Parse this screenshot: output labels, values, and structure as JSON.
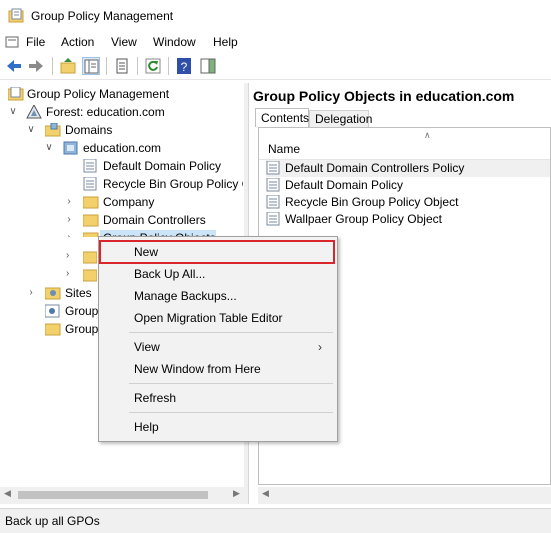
{
  "window": {
    "title": "Group Policy Management"
  },
  "menubar": {
    "items": [
      "File",
      "Action",
      "View",
      "Window",
      "Help"
    ]
  },
  "toolbar": {
    "icons": [
      "back-arrow-icon",
      "forward-arrow-icon",
      "up-folder-icon",
      "show-hide-tree-icon",
      "properties-icon",
      "refresh-icon",
      "help-icon",
      "action-pane-icon"
    ]
  },
  "tree": {
    "root": "Group Policy Management",
    "forest": "Forest: education.com",
    "domains": "Domains",
    "domain": "education.com",
    "items": [
      "Default Domain Policy",
      "Recycle Bin Group Policy O",
      "Company",
      "Domain Controllers",
      "Group Policy Objects"
    ],
    "sites": "Sites",
    "group1": "Group",
    "group2": "Group"
  },
  "right_pane": {
    "title": "Group Policy Objects in education.com",
    "tabs": [
      "Contents",
      "Delegation"
    ],
    "column_header": "Name",
    "rows": [
      "Default Domain Controllers Policy",
      "Default Domain Policy",
      "Recycle Bin Group Policy Object",
      "Wallpaer Group Policy Object"
    ]
  },
  "context_menu": {
    "items": [
      "New",
      "Back Up All...",
      "Manage Backups...",
      "Open Migration Table Editor",
      "View",
      "New Window from Here",
      "Refresh",
      "Help"
    ],
    "highlighted": "New"
  },
  "statusbar": {
    "text": "Back up all GPOs"
  },
  "colors": {
    "highlight_border": "#d9262c",
    "selection": "#cce4f7",
    "folder": "#f2d06b"
  }
}
